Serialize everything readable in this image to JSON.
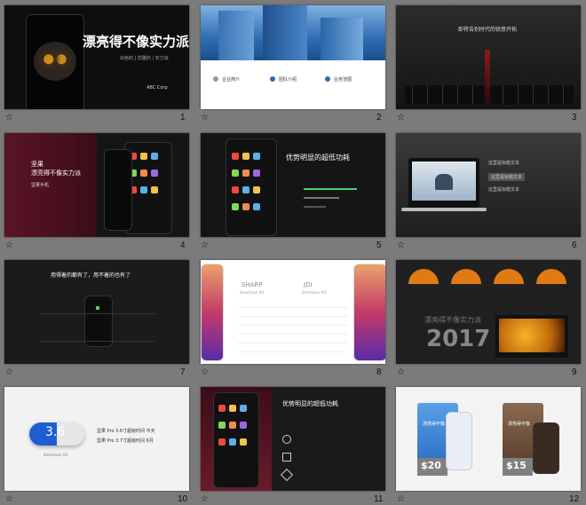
{
  "slides": [
    {
      "number": "1",
      "title": "漂亮得不像实力派",
      "line1": "出色的 | 优雅的 | 实力派",
      "line2": "ABC Corp"
    },
    {
      "number": "2",
      "features": [
        "企业简介",
        "团队介绍",
        "业务范围"
      ]
    },
    {
      "number": "3",
      "title": "即将告别时代的锐意开拓"
    },
    {
      "number": "4",
      "title_line1": "坚果",
      "title_line2": "漂亮得不像实力派",
      "sub": "坚果手机"
    },
    {
      "number": "5",
      "title": "优势明显的超低功耗"
    },
    {
      "number": "6",
      "rows": [
        "这里是标题文本",
        "这里是标题文本",
        "这里是标题文本"
      ]
    },
    {
      "number": "7",
      "title": "用得着的都有了，用不着的也有了"
    },
    {
      "number": "8",
      "brand_left": "SHARP",
      "brand_right": "JDI",
      "sub_left": "Smartisan M1",
      "sub_right": "Smartisan M1"
    },
    {
      "number": "9",
      "heading": "漂亮得不像实力派",
      "year": "2017"
    },
    {
      "number": "10",
      "pill_value": "3.6",
      "line1": "坚果 Pro 3.6寸超级时间   今天",
      "line2": "坚果 Pro 3.7寸超级时间   6月",
      "caption": "Smartisan OS"
    },
    {
      "number": "11",
      "title": "优势明显的超低功耗"
    },
    {
      "number": "12",
      "label_left": "漂亮得不像",
      "label_right": "漂亮得不像",
      "price_left": "$20",
      "price_right": "$15"
    }
  ],
  "star_icon_label": "☆",
  "colors": {
    "accent_green": "#4fd26b",
    "accent_orange": "#e07a12",
    "accent_maroon": "#6b1a2a"
  }
}
